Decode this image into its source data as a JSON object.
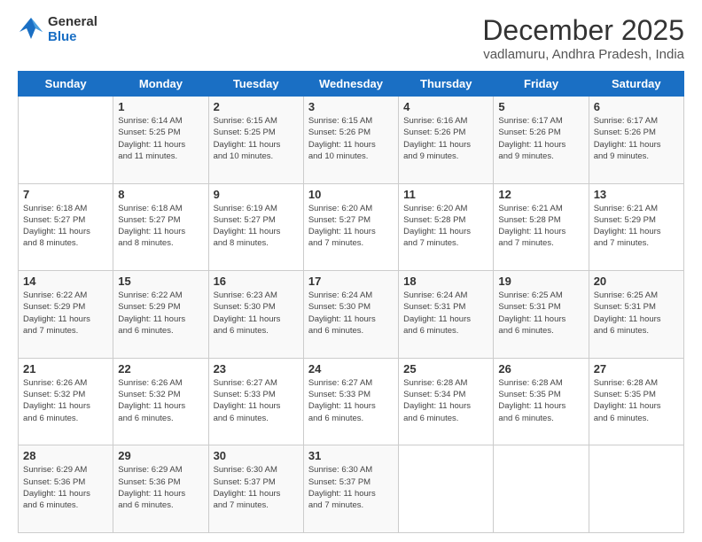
{
  "header": {
    "logo_line1": "General",
    "logo_line2": "Blue",
    "month": "December 2025",
    "location": "vadlamuru, Andhra Pradesh, India"
  },
  "weekdays": [
    "Sunday",
    "Monday",
    "Tuesday",
    "Wednesday",
    "Thursday",
    "Friday",
    "Saturday"
  ],
  "weeks": [
    [
      {
        "day": "",
        "info": ""
      },
      {
        "day": "1",
        "info": "Sunrise: 6:14 AM\nSunset: 5:25 PM\nDaylight: 11 hours\nand 11 minutes."
      },
      {
        "day": "2",
        "info": "Sunrise: 6:15 AM\nSunset: 5:25 PM\nDaylight: 11 hours\nand 10 minutes."
      },
      {
        "day": "3",
        "info": "Sunrise: 6:15 AM\nSunset: 5:26 PM\nDaylight: 11 hours\nand 10 minutes."
      },
      {
        "day": "4",
        "info": "Sunrise: 6:16 AM\nSunset: 5:26 PM\nDaylight: 11 hours\nand 9 minutes."
      },
      {
        "day": "5",
        "info": "Sunrise: 6:17 AM\nSunset: 5:26 PM\nDaylight: 11 hours\nand 9 minutes."
      },
      {
        "day": "6",
        "info": "Sunrise: 6:17 AM\nSunset: 5:26 PM\nDaylight: 11 hours\nand 9 minutes."
      }
    ],
    [
      {
        "day": "7",
        "info": "Sunrise: 6:18 AM\nSunset: 5:27 PM\nDaylight: 11 hours\nand 8 minutes."
      },
      {
        "day": "8",
        "info": "Sunrise: 6:18 AM\nSunset: 5:27 PM\nDaylight: 11 hours\nand 8 minutes."
      },
      {
        "day": "9",
        "info": "Sunrise: 6:19 AM\nSunset: 5:27 PM\nDaylight: 11 hours\nand 8 minutes."
      },
      {
        "day": "10",
        "info": "Sunrise: 6:20 AM\nSunset: 5:27 PM\nDaylight: 11 hours\nand 7 minutes."
      },
      {
        "day": "11",
        "info": "Sunrise: 6:20 AM\nSunset: 5:28 PM\nDaylight: 11 hours\nand 7 minutes."
      },
      {
        "day": "12",
        "info": "Sunrise: 6:21 AM\nSunset: 5:28 PM\nDaylight: 11 hours\nand 7 minutes."
      },
      {
        "day": "13",
        "info": "Sunrise: 6:21 AM\nSunset: 5:29 PM\nDaylight: 11 hours\nand 7 minutes."
      }
    ],
    [
      {
        "day": "14",
        "info": "Sunrise: 6:22 AM\nSunset: 5:29 PM\nDaylight: 11 hours\nand 7 minutes."
      },
      {
        "day": "15",
        "info": "Sunrise: 6:22 AM\nSunset: 5:29 PM\nDaylight: 11 hours\nand 6 minutes."
      },
      {
        "day": "16",
        "info": "Sunrise: 6:23 AM\nSunset: 5:30 PM\nDaylight: 11 hours\nand 6 minutes."
      },
      {
        "day": "17",
        "info": "Sunrise: 6:24 AM\nSunset: 5:30 PM\nDaylight: 11 hours\nand 6 minutes."
      },
      {
        "day": "18",
        "info": "Sunrise: 6:24 AM\nSunset: 5:31 PM\nDaylight: 11 hours\nand 6 minutes."
      },
      {
        "day": "19",
        "info": "Sunrise: 6:25 AM\nSunset: 5:31 PM\nDaylight: 11 hours\nand 6 minutes."
      },
      {
        "day": "20",
        "info": "Sunrise: 6:25 AM\nSunset: 5:31 PM\nDaylight: 11 hours\nand 6 minutes."
      }
    ],
    [
      {
        "day": "21",
        "info": "Sunrise: 6:26 AM\nSunset: 5:32 PM\nDaylight: 11 hours\nand 6 minutes."
      },
      {
        "day": "22",
        "info": "Sunrise: 6:26 AM\nSunset: 5:32 PM\nDaylight: 11 hours\nand 6 minutes."
      },
      {
        "day": "23",
        "info": "Sunrise: 6:27 AM\nSunset: 5:33 PM\nDaylight: 11 hours\nand 6 minutes."
      },
      {
        "day": "24",
        "info": "Sunrise: 6:27 AM\nSunset: 5:33 PM\nDaylight: 11 hours\nand 6 minutes."
      },
      {
        "day": "25",
        "info": "Sunrise: 6:28 AM\nSunset: 5:34 PM\nDaylight: 11 hours\nand 6 minutes."
      },
      {
        "day": "26",
        "info": "Sunrise: 6:28 AM\nSunset: 5:35 PM\nDaylight: 11 hours\nand 6 minutes."
      },
      {
        "day": "27",
        "info": "Sunrise: 6:28 AM\nSunset: 5:35 PM\nDaylight: 11 hours\nand 6 minutes."
      }
    ],
    [
      {
        "day": "28",
        "info": "Sunrise: 6:29 AM\nSunset: 5:36 PM\nDaylight: 11 hours\nand 6 minutes."
      },
      {
        "day": "29",
        "info": "Sunrise: 6:29 AM\nSunset: 5:36 PM\nDaylight: 11 hours\nand 6 minutes."
      },
      {
        "day": "30",
        "info": "Sunrise: 6:30 AM\nSunset: 5:37 PM\nDaylight: 11 hours\nand 7 minutes."
      },
      {
        "day": "31",
        "info": "Sunrise: 6:30 AM\nSunset: 5:37 PM\nDaylight: 11 hours\nand 7 minutes."
      },
      {
        "day": "",
        "info": ""
      },
      {
        "day": "",
        "info": ""
      },
      {
        "day": "",
        "info": ""
      }
    ]
  ]
}
